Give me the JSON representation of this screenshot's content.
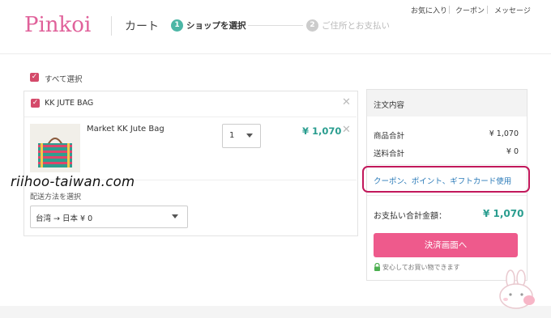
{
  "header": {
    "logo_text": "Pinkoi",
    "cart_title": "カート",
    "steps": [
      {
        "number": "1",
        "label": "ショップを選択"
      },
      {
        "number": "2",
        "label": "ご住所とお支払い"
      }
    ],
    "top_links": [
      "お気に入り",
      "クーポン",
      "メッセージ"
    ]
  },
  "cart": {
    "select_all_label": "すべて選択",
    "shop": {
      "name": "KK JUTE BAG",
      "item": {
        "name": "Market KK Jute Bag",
        "quantity": "1",
        "price": "¥ 1,070"
      },
      "shipping_label": "配送方法を選択",
      "shipping_value": "台湾 → 日本 ¥ 0"
    }
  },
  "watermark": "riihoo-taiwan.com",
  "summary": {
    "title": "注文内容",
    "subtotal_label": "商品合計",
    "subtotal_value": "¥ 1,070",
    "shipping_label": "送料合計",
    "shipping_value": "¥ 0",
    "coupon_link": "クーポン、ポイント、ギフトカード使用",
    "total_label": "お支払い合計金額：",
    "total_value": "¥ 1,070",
    "checkout_button": "決済画面へ",
    "secure_note": "安心してお買い物できます"
  },
  "colors": {
    "brand_pink": "#e0619a",
    "accent_teal": "#2a9d8f",
    "checkout_pink": "#ee5a8c",
    "highlight": "#c2185b",
    "link_blue": "#2a7ab8"
  }
}
